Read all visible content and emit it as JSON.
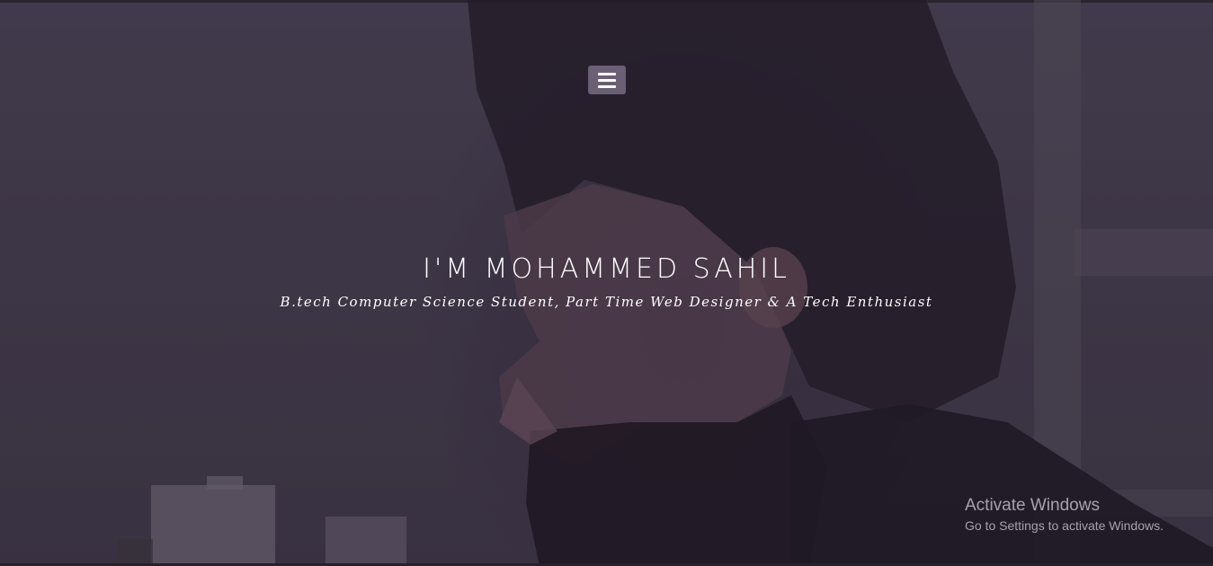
{
  "hero": {
    "title": "I'M MOHAMMED SAHIL",
    "subtitle": "B.tech Computer Science Student, Part Time Web Designer & A Tech Enthusiast"
  },
  "nav": {
    "menu_icon": "hamburger-menu-icon"
  },
  "watermark": {
    "title": "Activate Windows",
    "subtitle": "Go to Settings to activate Windows."
  },
  "colors": {
    "menu_button_bg": "#6a5f74",
    "text": "#ffffff"
  }
}
